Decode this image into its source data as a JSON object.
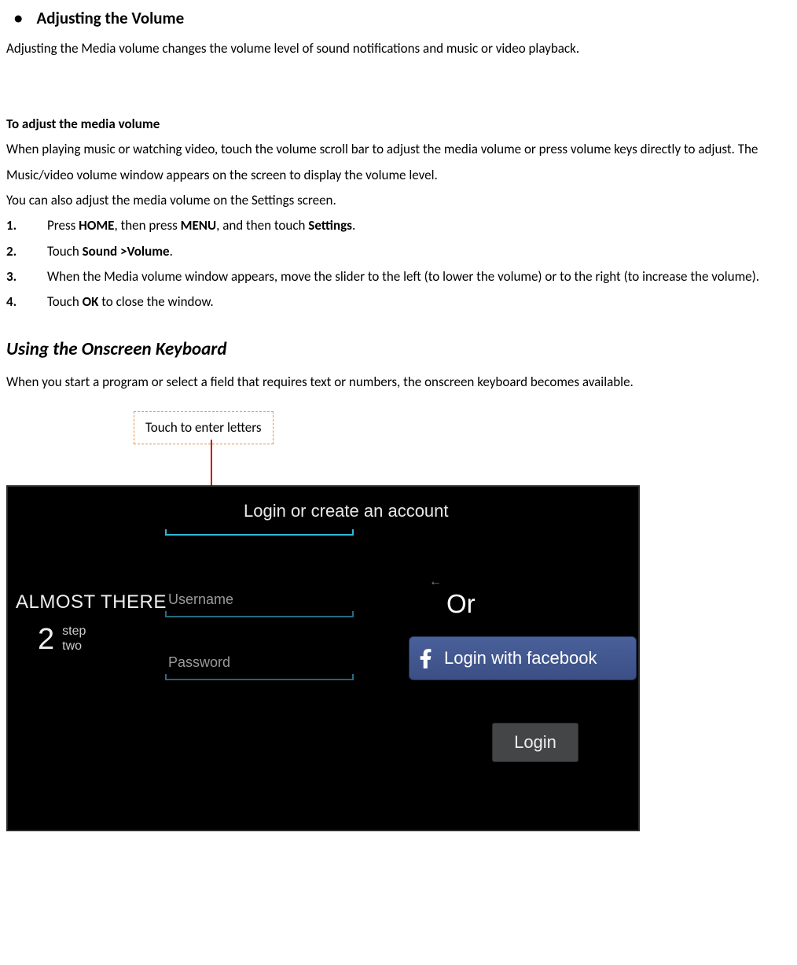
{
  "section1": {
    "title": "Adjusting the Volume",
    "intro": "Adjusting the Media volume changes the volume level of sound notifications and music or video playback."
  },
  "media": {
    "subhead": "To adjust the media volume",
    "p1": "When playing music or watching video, touch the volume scroll bar to adjust the media volume or press volume keys directly to adjust. The Music/video volume window appears on the screen to display the volume level.",
    "p2": "You can also adjust the media volume on the Settings screen.",
    "steps": {
      "s1": {
        "pre": "Press ",
        "b1": "HOME",
        "mid1": ", then press ",
        "b2": "MENU",
        "mid2": ", and then touch ",
        "b3": "Settings",
        "post": "."
      },
      "s2": {
        "pre": "Touch ",
        "b1": "Sound >Volume",
        "post": "."
      },
      "s3": "When the Media volume window appears, move the slider to the left (to lower the volume) or to the right (to increase the volume).",
      "s4": {
        "pre": "Touch ",
        "b1": "OK",
        "post": " to close the window."
      }
    }
  },
  "kb": {
    "title": "Using the Onscreen Keyboard",
    "intro": "When you start a program or select a field that requires text or numbers, the onscreen keyboard becomes available."
  },
  "callout": "Touch to enter letters",
  "phone": {
    "almost": "ALMOST THERE",
    "step_num": "2",
    "step_label_1": "step",
    "step_label_2": "two",
    "title": "Login or create an account",
    "username_ph": "Username",
    "password_ph": "Password",
    "or": "Or",
    "fb_label": "Login with facebook",
    "login_label": "Login",
    "caret": "←"
  }
}
